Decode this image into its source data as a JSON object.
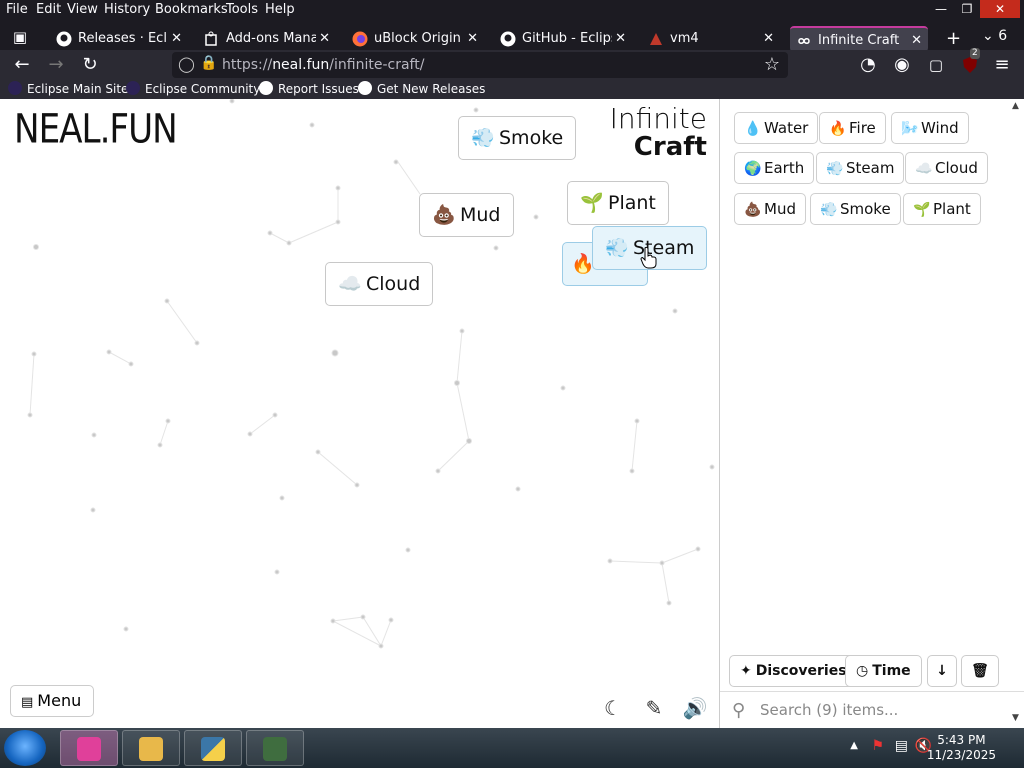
{
  "menubar": {
    "items": [
      "File",
      "Edit",
      "View",
      "History",
      "Bookmarks",
      "Tools",
      "Help"
    ]
  },
  "tabs": [
    {
      "label": "Releases · Eclipse",
      "icon": "github-icon"
    },
    {
      "label": "Add-ons Manage",
      "icon": "puzzle-icon"
    },
    {
      "label": "uBlock Origin – C",
      "icon": "firefox-icon"
    },
    {
      "label": "GitHub - Eclipse-",
      "icon": "github-icon"
    },
    {
      "label": "vm4",
      "icon": "vm-icon"
    },
    {
      "label": "Infinite Craft",
      "icon": "infinity-icon",
      "active": true
    }
  ],
  "tab_overflow_count": "6",
  "url": {
    "prefix": "https://",
    "host": "neal.fun",
    "path": "/infinite-craft/"
  },
  "extension_badge": "2",
  "bookmarks": [
    "Eclipse Main Site",
    "Eclipse Community",
    "Report Issues",
    "Get New Releases"
  ],
  "page": {
    "logo": "NEAL.FUN",
    "title_line1": "Infinite",
    "title_line2": "Craft",
    "canvas_elements": [
      {
        "name": "Smoke",
        "emoji": "💨"
      },
      {
        "name": "Mud",
        "emoji": "💩"
      },
      {
        "name": "Plant",
        "emoji": "🌱"
      },
      {
        "name": "Cloud",
        "emoji": "☁️"
      },
      {
        "name": "Steam",
        "emoji": "💨"
      },
      {
        "name": "Fire",
        "emoji": "🔥"
      }
    ],
    "menu_label": "Menu",
    "sidebar_items": [
      {
        "name": "Water",
        "emoji": "💧"
      },
      {
        "name": "Fire",
        "emoji": "🔥"
      },
      {
        "name": "Wind",
        "emoji": "🌬️"
      },
      {
        "name": "Earth",
        "emoji": "🌍"
      },
      {
        "name": "Steam",
        "emoji": "💨"
      },
      {
        "name": "Cloud",
        "emoji": "☁️"
      },
      {
        "name": "Mud",
        "emoji": "💩"
      },
      {
        "name": "Smoke",
        "emoji": "💨"
      },
      {
        "name": "Plant",
        "emoji": "🌱"
      }
    ],
    "discoveries_label": "Discoveries",
    "time_label": "Time",
    "search_placeholder": "Search (9) items..."
  },
  "taskbar": {
    "time": "5:43 PM",
    "date": "11/23/2025"
  }
}
